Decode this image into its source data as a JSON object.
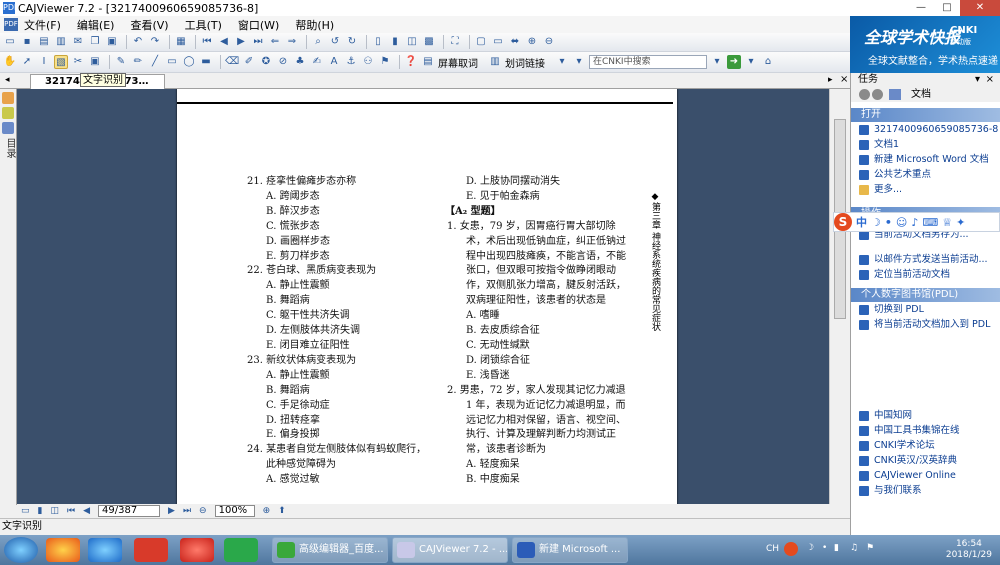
{
  "window": {
    "title": "CAJViewer 7.2 - [3217400960659085736-8]",
    "app_icon": "PDF"
  },
  "window_buttons": [
    "—",
    "□",
    "✕"
  ],
  "menu": [
    "文件(F)",
    "编辑(E)",
    "查看(V)",
    "工具(T)",
    "窗口(W)",
    "帮助(H)"
  ],
  "toolbar2": {
    "screen_word": "屏幕取词",
    "line_link": "划词链接",
    "search_placeholder": "在CNKI中搜索"
  },
  "promo": {
    "title": "全球学术快报",
    "brand": "CNKI",
    "sub": "移动版",
    "tagline": "全球文献整合，学术热点速递"
  },
  "tab": {
    "label": "321740…008573…",
    "tooltip": "文字识别"
  },
  "left_panel_label": "目录",
  "document": {
    "col1": [
      {
        "k": "q",
        "t": "21. 痉挛性偏瘫步态亦称"
      },
      {
        "k": "opt",
        "t": "A. 跨阈步态"
      },
      {
        "k": "opt",
        "t": "B. 醉汉步态"
      },
      {
        "k": "opt",
        "t": "C. 慌张步态"
      },
      {
        "k": "opt",
        "t": "D. 画圈样步态"
      },
      {
        "k": "opt",
        "t": "E. 剪刀样步态"
      },
      {
        "k": "q",
        "t": "22. 苍白球、黑质病变表现为"
      },
      {
        "k": "opt",
        "t": "A. 静止性震颤"
      },
      {
        "k": "opt",
        "t": "B. 舞蹈病"
      },
      {
        "k": "opt",
        "t": "C. 躯干性共济失调"
      },
      {
        "k": "opt",
        "t": "D. 左侧肢体共济失调"
      },
      {
        "k": "opt",
        "t": "E. 闭目难立征阳性"
      },
      {
        "k": "q",
        "t": "23. 新纹状体病变表现为"
      },
      {
        "k": "opt",
        "t": "A. 静止性震颤"
      },
      {
        "k": "opt",
        "t": "B. 舞蹈病"
      },
      {
        "k": "opt",
        "t": "C. 手足徐动症"
      },
      {
        "k": "opt",
        "t": "D. 扭转痉挛"
      },
      {
        "k": "opt",
        "t": "E. 偏身投掷"
      },
      {
        "k": "q",
        "t": "24. 某患者自觉左侧肢体似有蚂蚁爬行，"
      },
      {
        "k": "cont",
        "t": "此种感觉障碍为"
      },
      {
        "k": "opt",
        "t": "A. 感觉过敏"
      }
    ],
    "col2": [
      {
        "k": "opt",
        "t": "D. 上肢协同摆动消失"
      },
      {
        "k": "opt",
        "t": "E. 见于帕金森病"
      },
      {
        "k": "head",
        "t": "【A₂ 型题】"
      },
      {
        "k": "q",
        "t": "1. 女患，79 岁，因胃癌行胃大部切除"
      },
      {
        "k": "cont",
        "t": "术，术后出现低钠血症，纠正低钠过"
      },
      {
        "k": "cont",
        "t": "程中出现四肢瘫痪，不能言语，不能"
      },
      {
        "k": "cont",
        "t": "张口，但双眼可按指令做睁闭眼动"
      },
      {
        "k": "cont",
        "t": "作，双侧肌张力增高，腱反射活跃，"
      },
      {
        "k": "cont",
        "t": "双病理征阳性，该患者的状态是"
      },
      {
        "k": "opt",
        "t": "A. 嗜睡"
      },
      {
        "k": "opt",
        "t": "B. 去皮质综合征"
      },
      {
        "k": "opt",
        "t": "C. 无动性缄默"
      },
      {
        "k": "opt",
        "t": "D. 闭锁综合征"
      },
      {
        "k": "opt",
        "t": "E. 浅昏迷"
      },
      {
        "k": "q",
        "t": "2. 男患，72 岁，家人发现其记忆力减退"
      },
      {
        "k": "cont",
        "t": "1 年，表现为近记忆力减退明显，而"
      },
      {
        "k": "cont",
        "t": "远记忆力相对保留，语言、视空间、"
      },
      {
        "k": "cont",
        "t": "执行、计算及理解判断力均测试正"
      },
      {
        "k": "cont",
        "t": "常，该患者诊断为"
      },
      {
        "k": "opt",
        "t": "A. 轻度痴呆"
      },
      {
        "k": "opt",
        "t": "B. 中度痴呆"
      }
    ],
    "side_label": "◆第三章 神经系统疾病的常见症状"
  },
  "bottom_nav": {
    "page": "49/387",
    "zoom": "100%"
  },
  "status": "文字识别",
  "taskpane": {
    "header": "任务",
    "nav_label": "文档",
    "open_section": "打开",
    "open_items": [
      "3217400960659085736-8",
      "文档1",
      "新建 Microsoft Word 文档",
      "公共艺术重点",
      "更多..."
    ],
    "ops_section": "操作",
    "ops_items": [
      "当前活动文档另存为...",
      "以邮件方式发送当前活动...",
      "定位当前活动文档"
    ],
    "pdl_section": "个人数字图书馆(PDL)",
    "pdl_items": [
      "切换到 PDL",
      "将当前活动文档加入到 PDL"
    ],
    "links": [
      "中国知网",
      "中国工具书集锦在线",
      "CNKI学术论坛",
      "CNKI英汉/汉英辞典",
      "CAJViewer Online",
      "与我们联系"
    ]
  },
  "sogou": {
    "mode": "中"
  },
  "taskbar": {
    "tasks": [
      "高级编辑器_百度...",
      "CAJViewer 7.2 - ...",
      "新建 Microsoft ..."
    ],
    "tray_lang": "CH",
    "time": "16:54",
    "date": "2018/1/29"
  },
  "colors": {
    "viewer_bg": "#3a4f6b",
    "promo_bg": "#0a5aa6",
    "taskbar": "#4f769e"
  }
}
